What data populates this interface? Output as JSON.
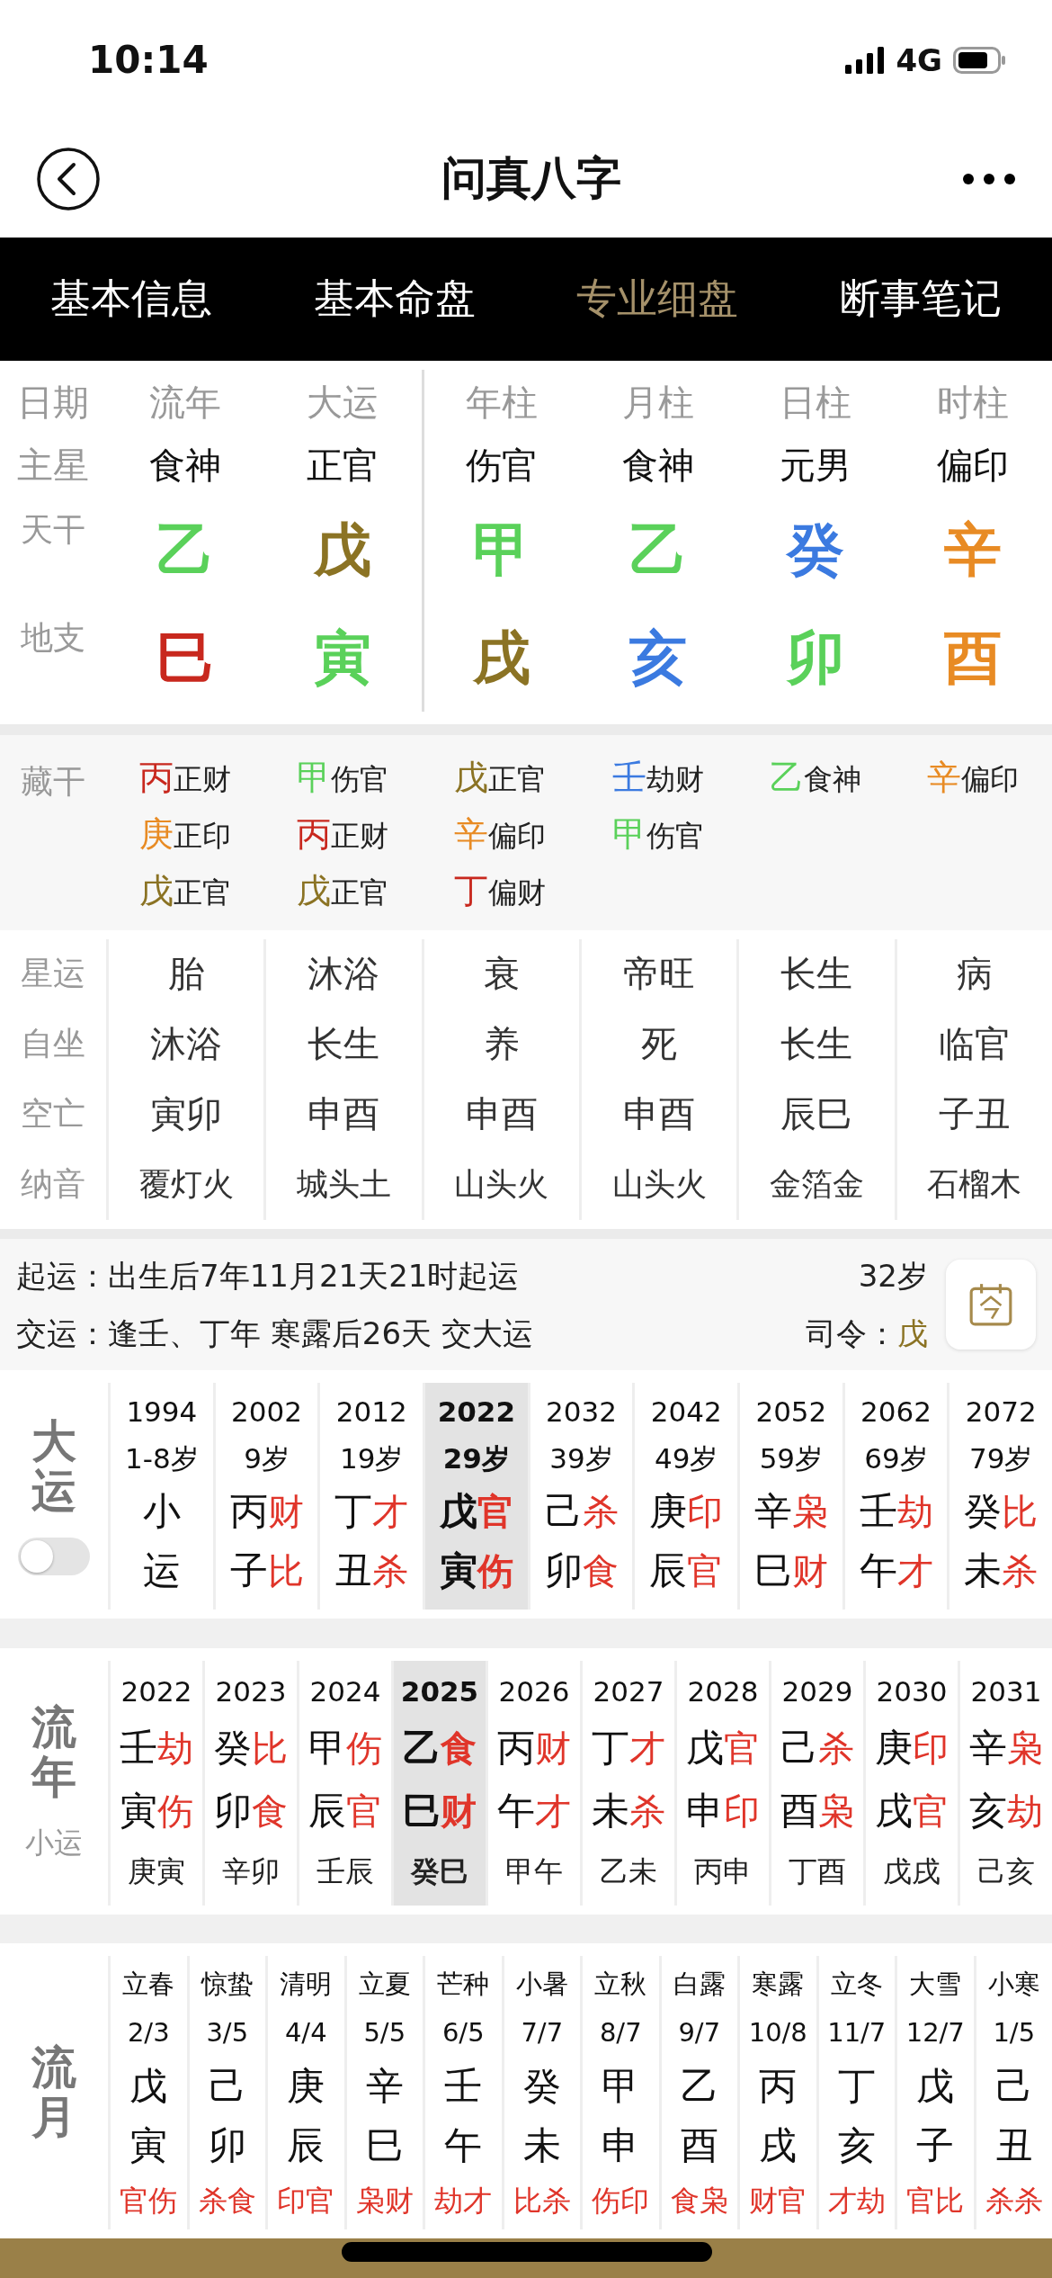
{
  "status_bar": {
    "time": "10:14",
    "network": "4G"
  },
  "nav": {
    "title": "问真八字"
  },
  "tabs": [
    {
      "label": "基本信息",
      "selected": false
    },
    {
      "label": "基本命盘",
      "selected": false
    },
    {
      "label": "专业细盘",
      "selected": true
    },
    {
      "label": "断事笔记",
      "selected": false
    }
  ],
  "pillars": {
    "row_labels": [
      "日期",
      "主星",
      "天干",
      "地支"
    ],
    "columns": [
      {
        "title": "流年",
        "main_star": "食神",
        "stem": {
          "text": "乙",
          "color": "#5ad15a"
        },
        "branch": {
          "text": "巳",
          "color": "#c8281e"
        }
      },
      {
        "title": "大运",
        "main_star": "正官",
        "stem": {
          "text": "戊",
          "color": "#8b7324"
        },
        "branch": {
          "text": "寅",
          "color": "#5ad15a"
        }
      },
      {
        "title": "年柱",
        "main_star": "伤官",
        "stem": {
          "text": "甲",
          "color": "#5ad15a"
        },
        "branch": {
          "text": "戌",
          "color": "#8b7324"
        }
      },
      {
        "title": "月柱",
        "main_star": "食神",
        "stem": {
          "text": "乙",
          "color": "#5ad15a"
        },
        "branch": {
          "text": "亥",
          "color": "#3b7ae0"
        }
      },
      {
        "title": "日柱",
        "main_star": "元男",
        "stem": {
          "text": "癸",
          "color": "#3b7ae0"
        },
        "branch": {
          "text": "卯",
          "color": "#5ad15a"
        }
      },
      {
        "title": "时柱",
        "main_star": "偏印",
        "stem": {
          "text": "辛",
          "color": "#e88b24"
        },
        "branch": {
          "text": "酉",
          "color": "#e88b24"
        }
      }
    ]
  },
  "hidden_stems": {
    "label": "藏干",
    "columns": [
      [
        {
          "stem": "丙",
          "color": "#c8281e",
          "god": "正财"
        },
        {
          "stem": "庚",
          "color": "#e88b24",
          "god": "正印"
        },
        {
          "stem": "戊",
          "color": "#8b7324",
          "god": "正官"
        }
      ],
      [
        {
          "stem": "甲",
          "color": "#5ad15a",
          "god": "伤官"
        },
        {
          "stem": "丙",
          "color": "#c8281e",
          "god": "正财"
        },
        {
          "stem": "戊",
          "color": "#8b7324",
          "god": "正官"
        }
      ],
      [
        {
          "stem": "戊",
          "color": "#8b7324",
          "god": "正官"
        },
        {
          "stem": "辛",
          "color": "#e88b24",
          "god": "偏印"
        },
        {
          "stem": "丁",
          "color": "#c8281e",
          "god": "偏财"
        }
      ],
      [
        {
          "stem": "壬",
          "color": "#3b7ae0",
          "god": "劫财"
        },
        {
          "stem": "甲",
          "color": "#5ad15a",
          "god": "伤官"
        }
      ],
      [
        {
          "stem": "乙",
          "color": "#5ad15a",
          "god": "食神"
        }
      ],
      [
        {
          "stem": "辛",
          "color": "#e88b24",
          "god": "偏印"
        }
      ]
    ]
  },
  "details": [
    {
      "label": "星运",
      "values": [
        "胎",
        "沐浴",
        "衰",
        "帝旺",
        "长生",
        "病"
      ]
    },
    {
      "label": "自坐",
      "values": [
        "沐浴",
        "长生",
        "养",
        "死",
        "长生",
        "临官"
      ]
    },
    {
      "label": "空亡",
      "values": [
        "寅卯",
        "申酉",
        "申酉",
        "申酉",
        "辰巳",
        "子丑"
      ]
    },
    {
      "label": "纳音",
      "values": [
        "覆灯火",
        "城头土",
        "山头火",
        "山头火",
        "金箔金",
        "石榴木"
      ]
    }
  ],
  "qiyun": {
    "lines": [
      {
        "label": "起运：",
        "text": "出生后7年11月21天21时起运"
      },
      {
        "label": "交运：",
        "text": "逢壬、丁年 寒露后26天 交大运"
      }
    ],
    "age": "32岁",
    "siling_label": "司令：",
    "siling_value": "戊"
  },
  "dayun": {
    "label": "大运",
    "toggle_on": false,
    "columns": [
      {
        "year": "1994",
        "age": "1-8岁",
        "stem": "小",
        "branch": "运",
        "selected": false
      },
      {
        "year": "2002",
        "age": "9岁",
        "stem": "丙",
        "stem_god": "财",
        "branch": "子",
        "branch_god": "比",
        "selected": false
      },
      {
        "year": "2012",
        "age": "19岁",
        "stem": "丁",
        "stem_god": "才",
        "branch": "丑",
        "branch_god": "杀",
        "selected": false
      },
      {
        "year": "2022",
        "age": "29岁",
        "stem": "戊",
        "stem_god": "官",
        "branch": "寅",
        "branch_god": "伤",
        "selected": true
      },
      {
        "year": "2032",
        "age": "39岁",
        "stem": "己",
        "stem_god": "杀",
        "branch": "卯",
        "branch_god": "食",
        "selected": false
      },
      {
        "year": "2042",
        "age": "49岁",
        "stem": "庚",
        "stem_god": "印",
        "branch": "辰",
        "branch_god": "官",
        "selected": false
      },
      {
        "year": "2052",
        "age": "59岁",
        "stem": "辛",
        "stem_god": "枭",
        "branch": "巳",
        "branch_god": "财",
        "selected": false
      },
      {
        "year": "2062",
        "age": "69岁",
        "stem": "壬",
        "stem_god": "劫",
        "branch": "午",
        "branch_god": "才",
        "selected": false
      },
      {
        "year": "2072",
        "age": "79岁",
        "stem": "癸",
        "stem_god": "比",
        "branch": "未",
        "branch_god": "杀",
        "selected": false
      }
    ]
  },
  "liunian": {
    "label": "流年",
    "sublabel": "小运",
    "columns": [
      {
        "year": "2022",
        "stem": "壬",
        "stem_god": "劫",
        "branch": "寅",
        "branch_god": "伤",
        "xiaoyun": "庚寅",
        "selected": false
      },
      {
        "year": "2023",
        "stem": "癸",
        "stem_god": "比",
        "branch": "卯",
        "branch_god": "食",
        "xiaoyun": "辛卯",
        "selected": false
      },
      {
        "year": "2024",
        "stem": "甲",
        "stem_god": "伤",
        "branch": "辰",
        "branch_god": "官",
        "xiaoyun": "壬辰",
        "selected": false
      },
      {
        "year": "2025",
        "stem": "乙",
        "stem_god": "食",
        "branch": "巳",
        "branch_god": "财",
        "xiaoyun": "癸巳",
        "selected": true
      },
      {
        "year": "2026",
        "stem": "丙",
        "stem_god": "财",
        "branch": "午",
        "branch_god": "才",
        "xiaoyun": "甲午",
        "selected": false
      },
      {
        "year": "2027",
        "stem": "丁",
        "stem_god": "才",
        "branch": "未",
        "branch_god": "杀",
        "xiaoyun": "乙未",
        "selected": false
      },
      {
        "year": "2028",
        "stem": "戊",
        "stem_god": "官",
        "branch": "申",
        "branch_god": "印",
        "xiaoyun": "丙申",
        "selected": false
      },
      {
        "year": "2029",
        "stem": "己",
        "stem_god": "杀",
        "branch": "酉",
        "branch_god": "枭",
        "xiaoyun": "丁酉",
        "selected": false
      },
      {
        "year": "2030",
        "stem": "庚",
        "stem_god": "印",
        "branch": "戌",
        "branch_god": "官",
        "xiaoyun": "戊戌",
        "selected": false
      },
      {
        "year": "2031",
        "stem": "辛",
        "stem_god": "枭",
        "branch": "亥",
        "branch_god": "劫",
        "xiaoyun": "己亥",
        "selected": false
      }
    ]
  },
  "liuyue": {
    "label": "流月",
    "columns": [
      {
        "term": "立春",
        "date": "2/3",
        "stem": "戊",
        "branch": "寅",
        "gods": "官伤"
      },
      {
        "term": "惊蛰",
        "date": "3/5",
        "stem": "己",
        "branch": "卯",
        "gods": "杀食"
      },
      {
        "term": "清明",
        "date": "4/4",
        "stem": "庚",
        "branch": "辰",
        "gods": "印官"
      },
      {
        "term": "立夏",
        "date": "5/5",
        "stem": "辛",
        "branch": "巳",
        "gods": "枭财"
      },
      {
        "term": "芒种",
        "date": "6/5",
        "stem": "壬",
        "branch": "午",
        "gods": "劫才"
      },
      {
        "term": "小暑",
        "date": "7/7",
        "stem": "癸",
        "branch": "未",
        "gods": "比杀"
      },
      {
        "term": "立秋",
        "date": "8/7",
        "stem": "甲",
        "branch": "申",
        "gods": "伤印"
      },
      {
        "term": "白露",
        "date": "9/7",
        "stem": "乙",
        "branch": "酉",
        "gods": "食枭"
      },
      {
        "term": "寒露",
        "date": "10/8",
        "stem": "丙",
        "branch": "戌",
        "gods": "财官"
      },
      {
        "term": "立冬",
        "date": "11/7",
        "stem": "丁",
        "branch": "亥",
        "gods": "才劫"
      },
      {
        "term": "大雪",
        "date": "12/7",
        "stem": "戊",
        "branch": "子",
        "gods": "官比"
      },
      {
        "term": "小寒",
        "date": "1/5",
        "stem": "己",
        "branch": "丑",
        "gods": "杀杀"
      }
    ]
  }
}
